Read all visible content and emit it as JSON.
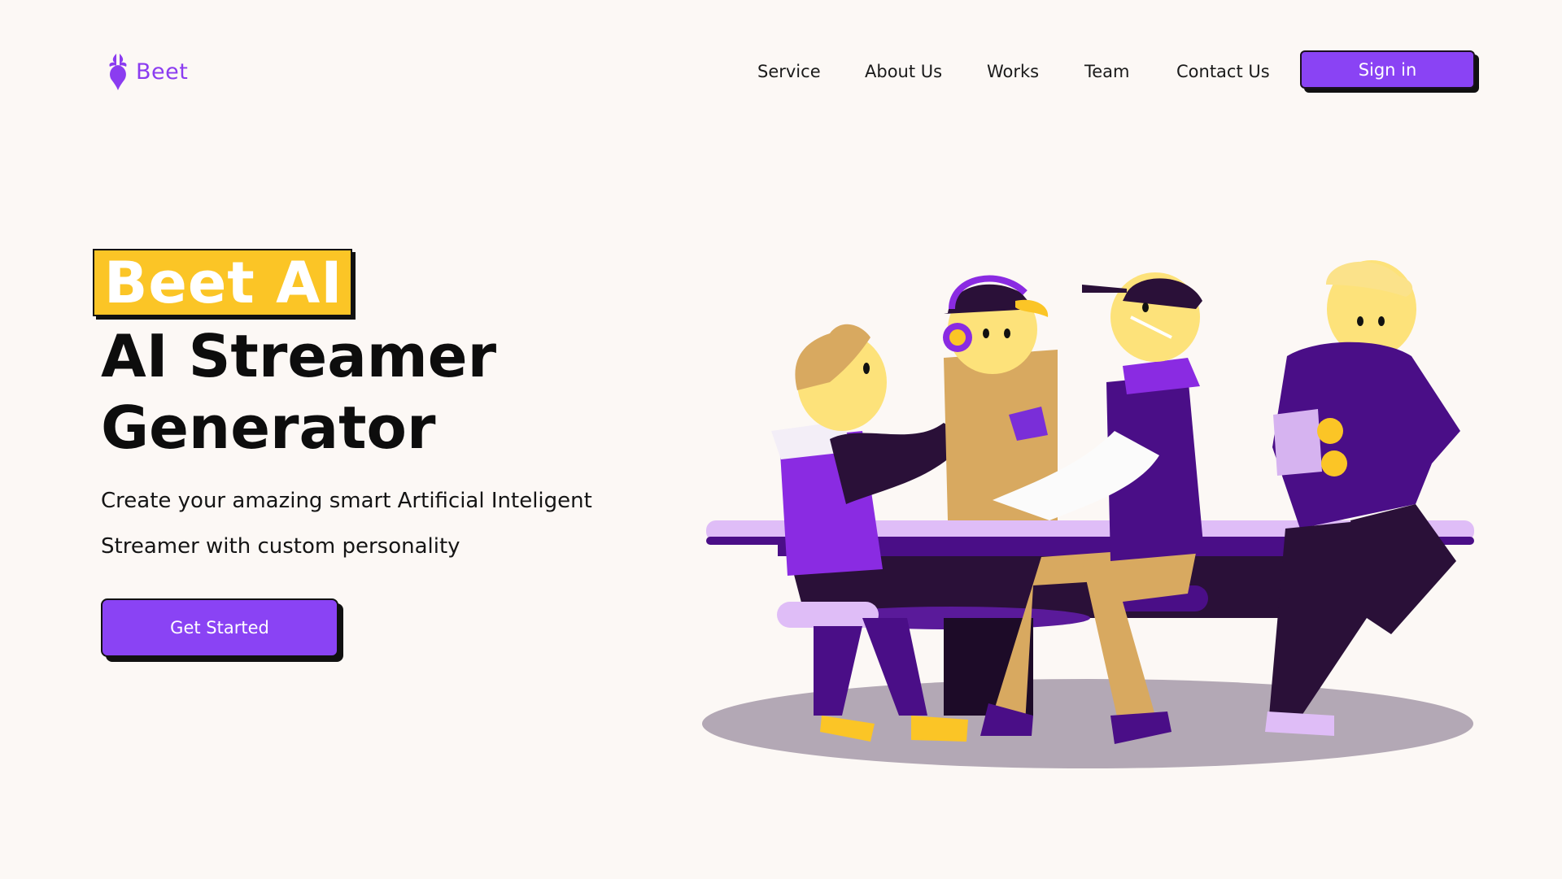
{
  "brand": {
    "name": "Beet",
    "logo_icon": "beet-icon",
    "accent_color": "#8a43f4",
    "highlight_color": "#fbc526"
  },
  "nav": {
    "items": [
      {
        "label": "Service"
      },
      {
        "label": "About Us"
      },
      {
        "label": "Works"
      },
      {
        "label": "Team"
      },
      {
        "label": "Contact Us"
      }
    ],
    "signin_label": "Sign in"
  },
  "hero": {
    "tag": "Beet AI",
    "title_line1": "AI Streamer",
    "title_line2": "Generator",
    "subtitle_line1": "Create your amazing smart Artificial Inteligent",
    "subtitle_line2": "Streamer with custom personality",
    "cta_label": "Get Started"
  }
}
